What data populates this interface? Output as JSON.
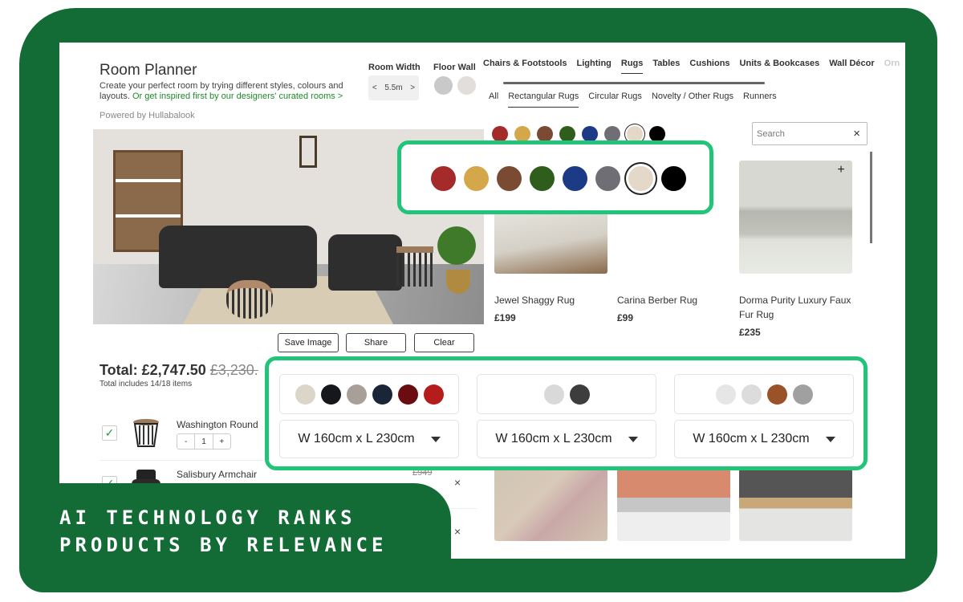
{
  "header": {
    "title": "Room Planner",
    "description": "Create your perfect room by trying different styles, colours and layouts.",
    "inspire_link": "Or get inspired first by our designers' curated rooms >",
    "powered_by": "Powered by Hullabalook"
  },
  "room_width": {
    "label": "Room Width",
    "dec": "<",
    "value": "5.5m",
    "inc": ">"
  },
  "floor_wall": {
    "label": "Floor Wall",
    "floor_color": "#c9c9c9",
    "wall_color": "#e1dedb"
  },
  "actions": {
    "save": "Save Image",
    "share": "Share",
    "clear": "Clear"
  },
  "total": {
    "label": "Total: £2,747.50",
    "original": "£3,230.",
    "sub": "Total includes 14/18 items"
  },
  "basket": [
    {
      "name": "Washington Round",
      "qty": "1",
      "minus": "-",
      "plus": "+",
      "checked": "✓"
    },
    {
      "name": "Salisbury Armchair",
      "old_price": "£949",
      "checked": "✓"
    }
  ],
  "remove_icon": "×",
  "categories": {
    "tabs": [
      "Chairs & Footstools",
      "Lighting",
      "Rugs",
      "Tables",
      "Cushions",
      "Units & Bookcases",
      "Wall Décor",
      "Orn"
    ],
    "active": "Rugs"
  },
  "subcategories": {
    "tabs": [
      "All",
      "Rectangular Rugs",
      "Circular Rugs",
      "Novelty / Other Rugs",
      "Runners"
    ],
    "active": "Rectangular Rugs"
  },
  "colour_filter": {
    "colors": [
      "#a52a2a",
      "#d4a84a",
      "#7a4a32",
      "#2f5e1c",
      "#1c3a86",
      "#6e6e74",
      "#e4d9c8",
      "#000000"
    ],
    "selected_index": 6
  },
  "search": {
    "placeholder": "Search",
    "clear_icon": "×"
  },
  "products": [
    {
      "name": "Jewel Shaggy Rug",
      "price": "£199",
      "swatches": [
        "#dcd6c8",
        "#15171c",
        "#a8a098",
        "#1a2638",
        "#6b0d10",
        "#b51c1c"
      ],
      "size": "W 160cm x L 230cm"
    },
    {
      "name": "Carina Berber Rug",
      "price": "£99",
      "swatches": [
        "#d9d9d9",
        "#3d3d3d"
      ],
      "size": "W 160cm x L 230cm"
    },
    {
      "name": "Dorma Purity Luxury Faux Fur Rug",
      "price": "£235",
      "swatches": [
        "#e6e6e6",
        "#dcdcdc",
        "#9a5228",
        "#a0a0a0"
      ],
      "size": "W 160cm x L 230cm"
    }
  ],
  "add_icon": "+",
  "caption": {
    "line1": "AI TECHNOLOGY RANKS",
    "line2": "PRODUCTS BY RELEVANCE"
  },
  "accent_colors": {
    "frame_green": "#136b35",
    "callout_green": "#22c47a",
    "link_green": "#1f8a2a"
  }
}
